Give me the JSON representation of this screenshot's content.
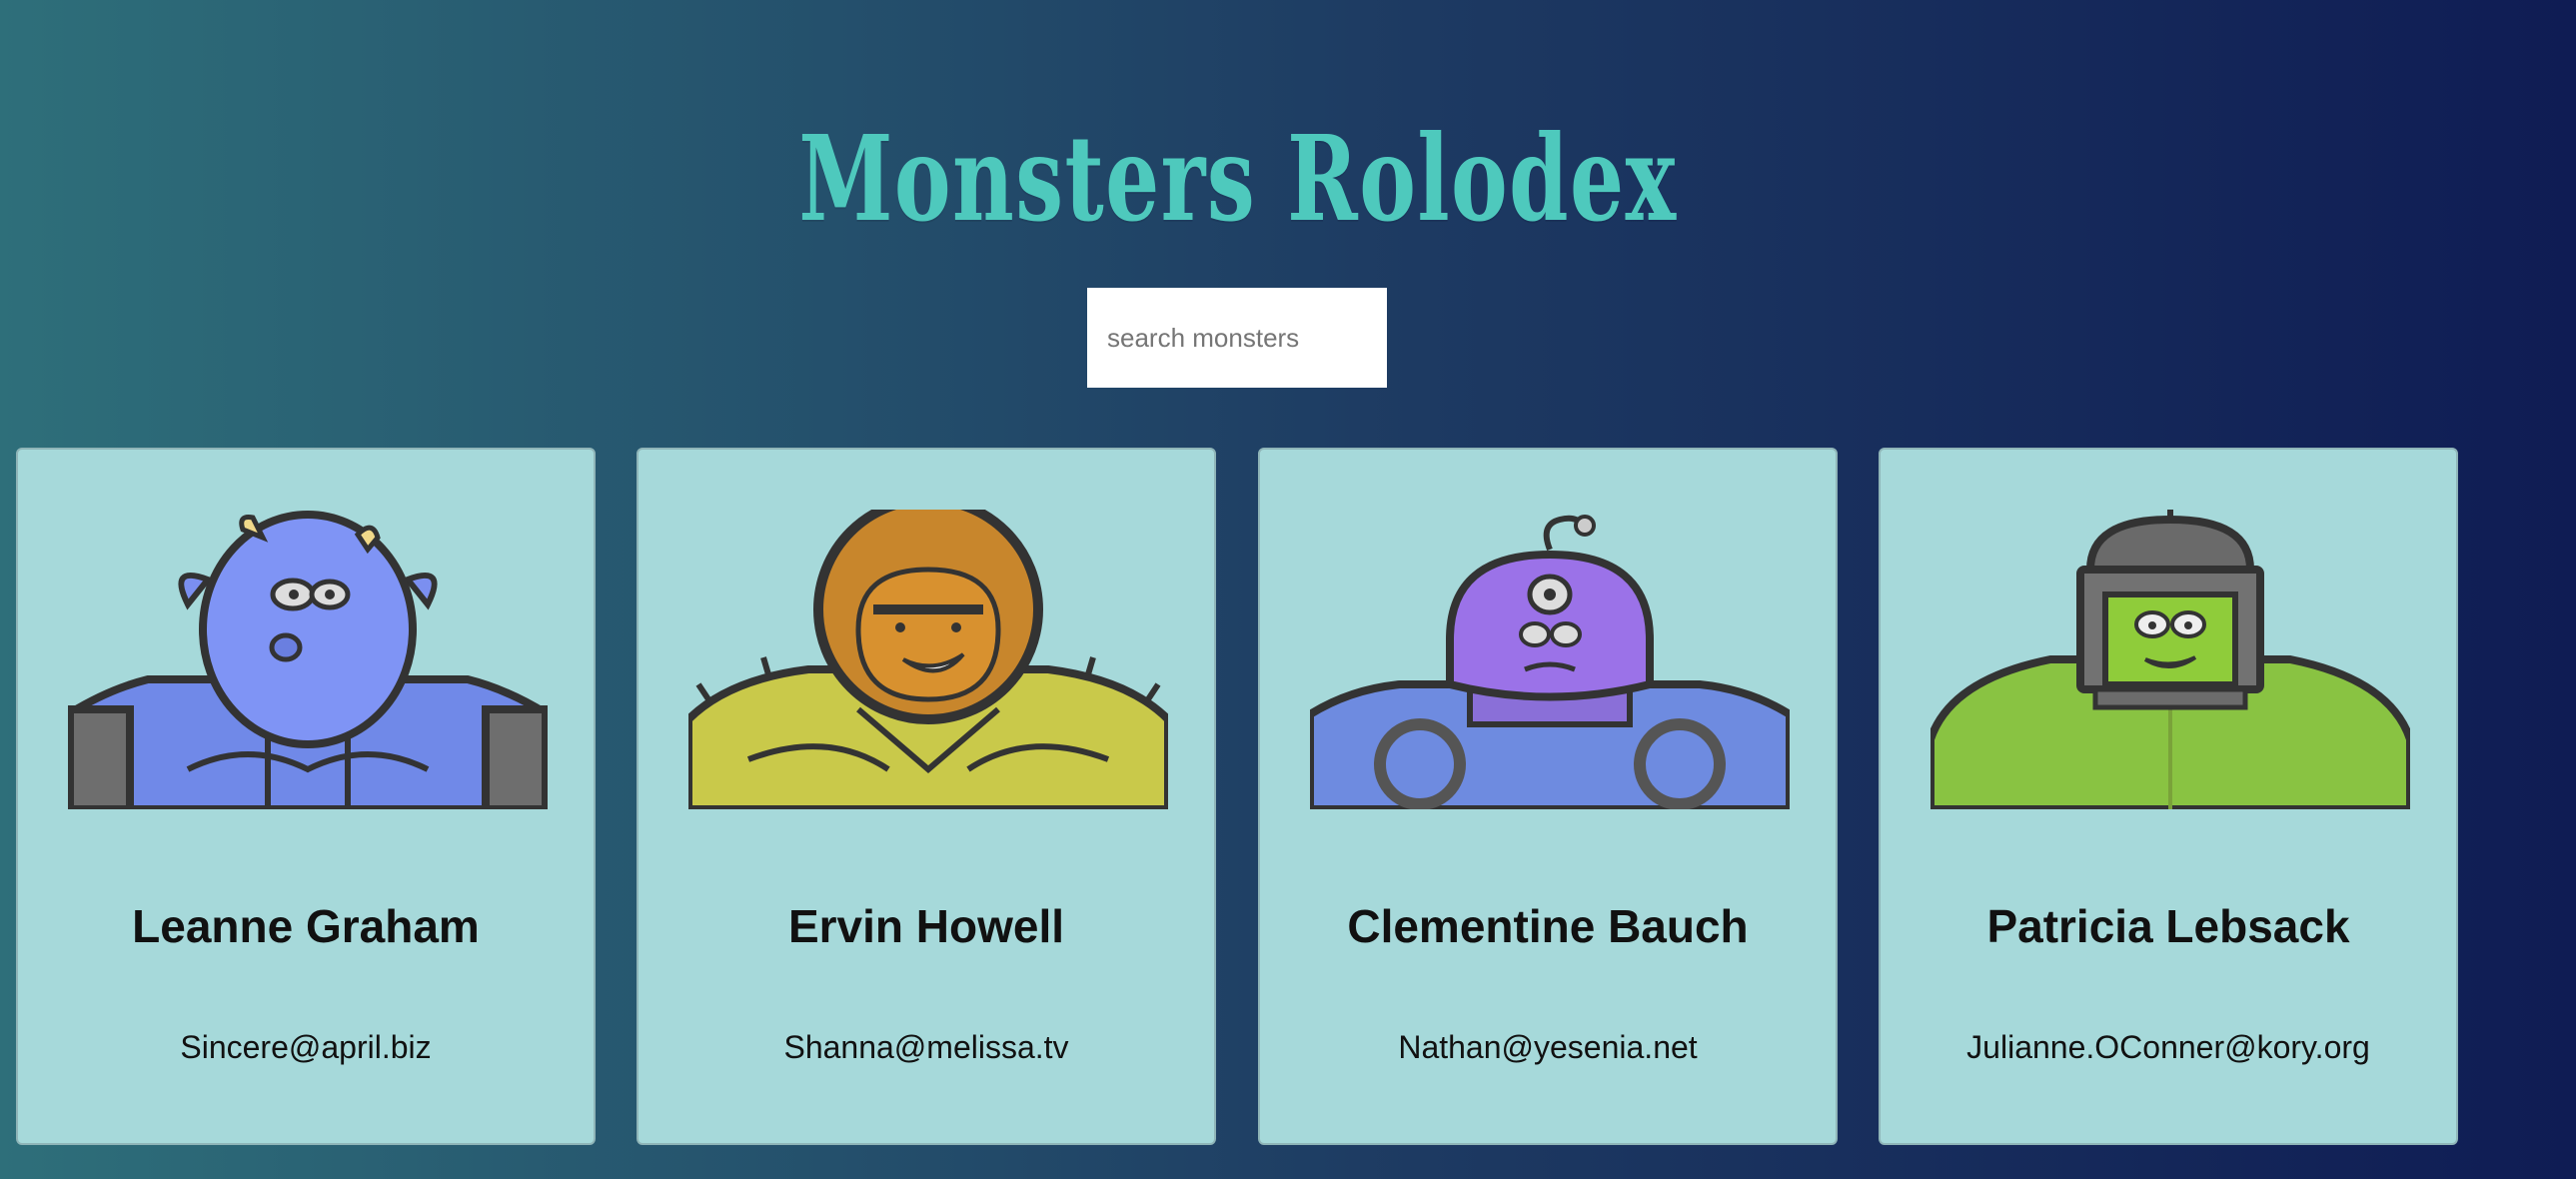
{
  "app": {
    "title": "Monsters Rolodex"
  },
  "search": {
    "placeholder": "search monsters",
    "value": ""
  },
  "monsters": [
    {
      "name": "Leanne Graham",
      "email": "Sincere@april.biz",
      "avatar_icon": "blue-horned-monster"
    },
    {
      "name": "Ervin Howell",
      "email": "Shanna@melissa.tv",
      "avatar_icon": "orange-spiky-monster"
    },
    {
      "name": "Clementine Bauch",
      "email": "Nathan@yesenia.net",
      "avatar_icon": "purple-cyclops-robot-monster"
    },
    {
      "name": "Patricia Lebsack",
      "email": "Julianne.OConner@kory.org",
      "avatar_icon": "green-helmet-monster"
    }
  ],
  "colors": {
    "title": "#4ec9bd",
    "card_bg": "#a6d9da",
    "bg_left": "#2e6f7a",
    "bg_right": "#0f1c54"
  }
}
